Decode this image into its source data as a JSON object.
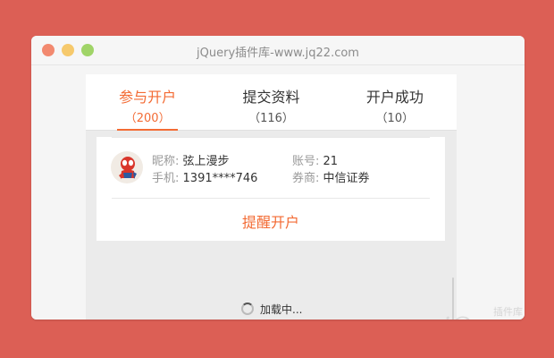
{
  "window": {
    "title": "jQuery插件库-www.jq22.com"
  },
  "tabs": [
    {
      "label": "参与开户",
      "count": "（200）"
    },
    {
      "label": "提交资料",
      "count": "（116）"
    },
    {
      "label": "开户成功",
      "count": "（10）"
    }
  ],
  "card": {
    "nickname_label": "昵称:",
    "nickname": "弦上漫步",
    "phone_label": "手机:",
    "phone": "1391****746",
    "account_label": "账号:",
    "account": "21",
    "broker_label": "券商:",
    "broker": "中信证券",
    "remind_button": "提醒开户"
  },
  "loading": {
    "text": "加载中..."
  },
  "watermark": {
    "brand": "jQuery",
    "sub": "插件库"
  },
  "colors": {
    "accent": "#f36b34",
    "background": "#dc5f55"
  }
}
